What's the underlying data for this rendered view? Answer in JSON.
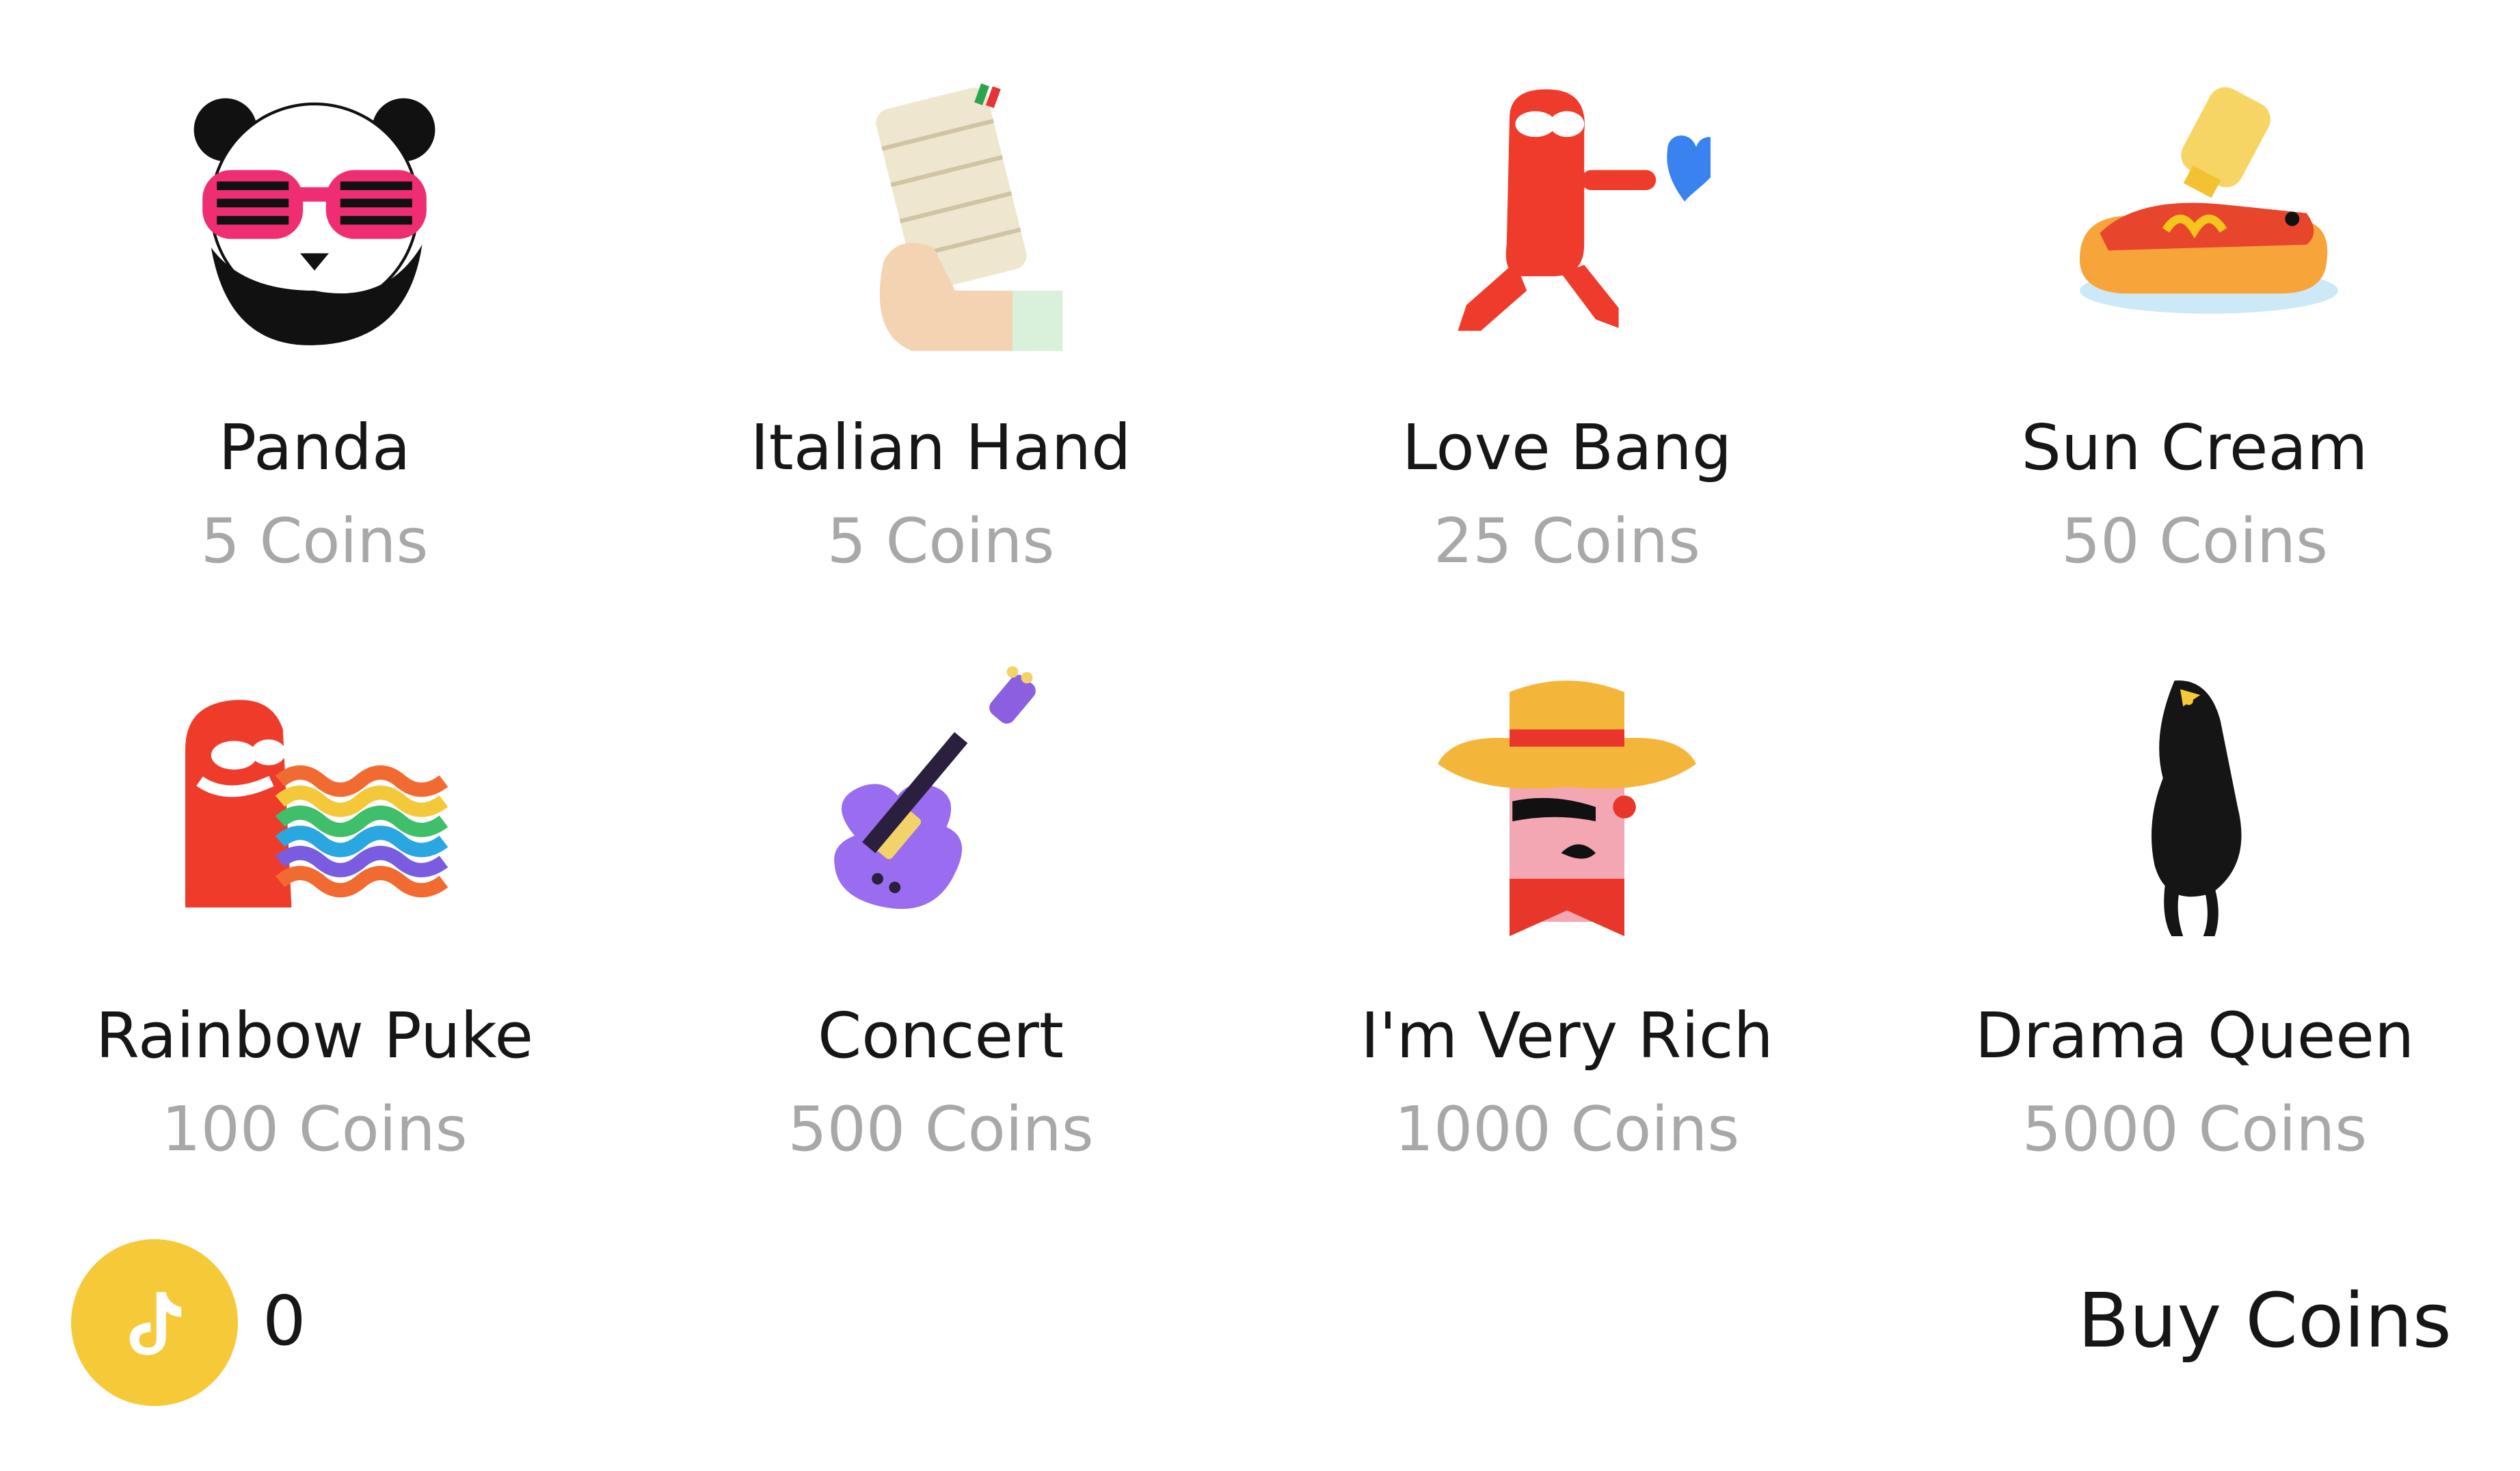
{
  "gifts": [
    {
      "name": "Panda",
      "price": "5 Coins",
      "icon": "panda-sunglasses-icon"
    },
    {
      "name": "Italian Hand",
      "price": "5 Coins",
      "icon": "leaning-tower-hand-icon"
    },
    {
      "name": "Love Bang",
      "price": "25 Coins",
      "icon": "love-bang-heart-icon"
    },
    {
      "name": "Sun Cream",
      "price": "50 Coins",
      "icon": "sun-cream-hotdog-icon"
    },
    {
      "name": "Rainbow Puke",
      "price": "100 Coins",
      "icon": "rainbow-puke-icon"
    },
    {
      "name": "Concert",
      "price": "500 Coins",
      "icon": "guitar-icon"
    },
    {
      "name": "I'm Very Rich",
      "price": "1000 Coins",
      "icon": "rich-cowboy-icon"
    },
    {
      "name": "Drama Queen",
      "price": "5000 Coins",
      "icon": "drama-queen-bird-icon"
    }
  ],
  "footer": {
    "balance": "0",
    "buy_label": "Buy Coins",
    "coin_icon": "tiktok-coin-icon"
  },
  "colors": {
    "coin_yellow": "#f5c938",
    "price_gray": "#a8a8a8",
    "text_dark": "#161616"
  }
}
